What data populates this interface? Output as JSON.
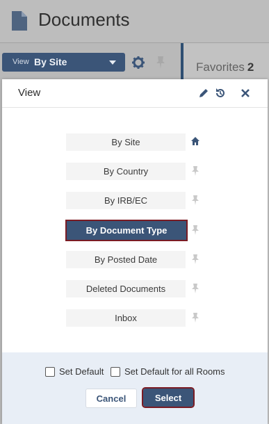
{
  "page": {
    "title": "Documents"
  },
  "toolbar": {
    "view_prefix": "View",
    "view_value": "By Site"
  },
  "favorites": {
    "label": "Favorites",
    "count": "2"
  },
  "modal": {
    "title": "View",
    "options": [
      {
        "label": "By Site",
        "icon": "home-icon"
      },
      {
        "label": "By Country",
        "icon": "pin-icon"
      },
      {
        "label": "By IRB/EC",
        "icon": "pin-icon"
      },
      {
        "label": "By Document Type",
        "icon": "pin-icon",
        "selected": true
      },
      {
        "label": "By Posted Date",
        "icon": "pin-icon"
      },
      {
        "label": "Deleted Documents",
        "icon": "pin-icon"
      },
      {
        "label": "Inbox",
        "icon": "pin-icon"
      }
    ],
    "set_default_label": "Set Default",
    "set_default_all_label": "Set Default for all Rooms",
    "cancel_label": "Cancel",
    "select_label": "Select"
  },
  "colors": {
    "accent": "#3b5578",
    "highlight_border": "#7a1b23",
    "footer_bg": "#e8eef6"
  }
}
